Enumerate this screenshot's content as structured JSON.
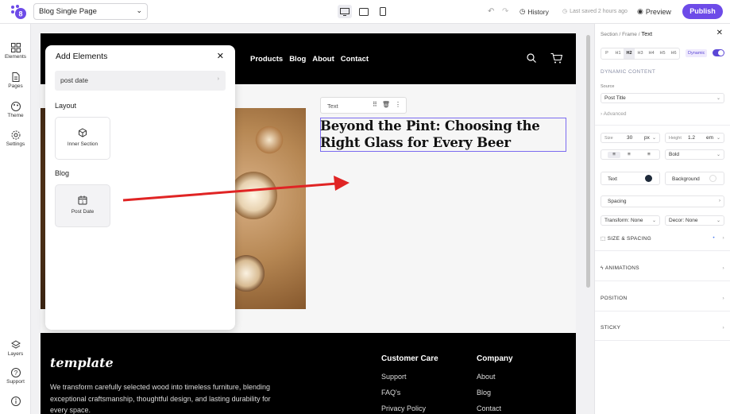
{
  "topbar": {
    "page_select": "Blog Single Page",
    "history_label": "History",
    "saved_text": "Last saved 2 hours ago",
    "preview_label": "Preview",
    "publish_label": "Publish"
  },
  "leftnav": {
    "items": [
      {
        "label": "Elements",
        "icon": "grid-icon"
      },
      {
        "label": "Pages",
        "icon": "document-icon"
      },
      {
        "label": "Theme",
        "icon": "palette-icon"
      },
      {
        "label": "Settings",
        "icon": "gear-icon"
      },
      {
        "label": "Layers",
        "icon": "layers-icon"
      },
      {
        "label": "Support",
        "icon": "help-icon"
      }
    ]
  },
  "site": {
    "nav": [
      "Products",
      "Blog",
      "About",
      "Contact"
    ],
    "post_title": "Beyond the Pint: Choosing the Right Glass for Every Beer",
    "toolbar_label": "Text",
    "footer": {
      "logo": "template",
      "description": "We transform carefully selected wood into timeless furniture, blending exceptional craftsmanship, thoughtful design, and lasting durability for every space.",
      "col1_title": "Customer Care",
      "col1_links": [
        "Support",
        "FAQ's",
        "Privacy Policy"
      ],
      "col2_title": "Company",
      "col2_links": [
        "About",
        "Blog",
        "Contact"
      ]
    }
  },
  "add_elements": {
    "title": "Add Elements",
    "search_value": "post date",
    "groups": [
      {
        "title": "Layout",
        "items": [
          {
            "label": "Inner Section",
            "icon": "cube-icon"
          }
        ]
      },
      {
        "title": "Blog",
        "items": [
          {
            "label": "Post Date",
            "icon": "calendar-icon"
          }
        ]
      }
    ]
  },
  "right_panel": {
    "breadcrumb": [
      "Section",
      "Frame",
      "Text"
    ],
    "heading_levels": [
      "P",
      "H1",
      "H2",
      "H3",
      "H4",
      "H5",
      "H6"
    ],
    "selected_level": "H2",
    "dynamic_badge": "Dynamic",
    "dynamic_section": "DYNAMIC CONTENT",
    "source_label": "Source",
    "source_value": "Post Title",
    "advanced_label": "Advanced",
    "size_label": "Size",
    "size_value": "30",
    "size_unit": "px",
    "height_label": "Height",
    "height_value": "1.2",
    "height_unit": "em",
    "weight_value": "Bold",
    "text_color_label": "Text",
    "background_label": "Background",
    "spacing_label": "Spacing",
    "transform_value": "Transform: None",
    "decor_value": "Decor: None",
    "size_spacing_label": "SIZE & SPACING",
    "animations_label": "ANIMATIONS",
    "position_label": "POSITION",
    "sticky_label": "STICKY",
    "accent_color": "#6d4be8"
  }
}
